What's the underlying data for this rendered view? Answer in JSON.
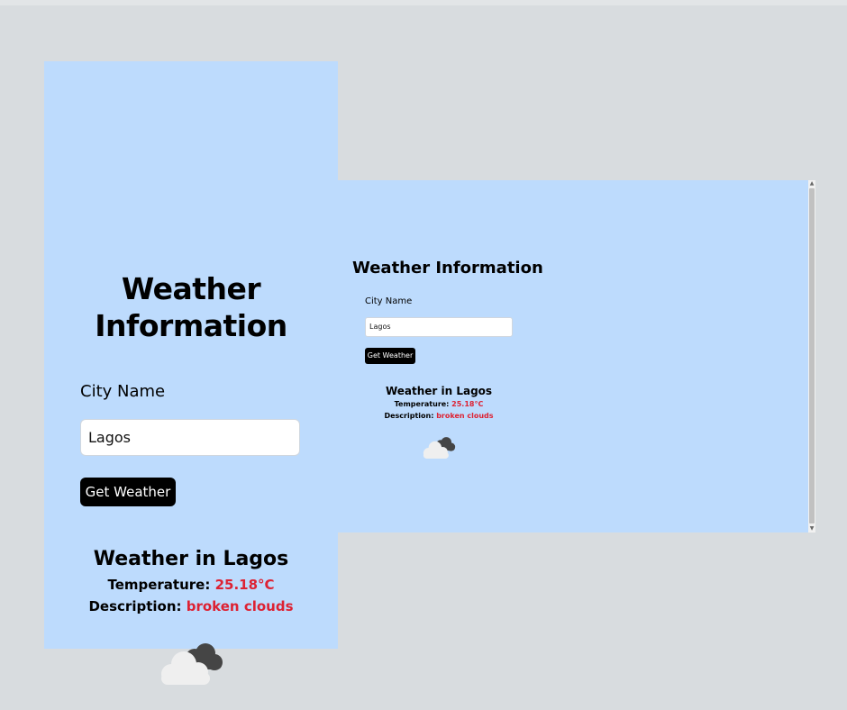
{
  "mobile": {
    "title": "Weather Information",
    "city_label": "City Name",
    "city_value": "Lagos",
    "button_label": "Get Weather",
    "result_title": "Weather in Lagos",
    "temperature_label": "Temperature: ",
    "temperature_value": "25.18°C",
    "description_label": "Description: ",
    "description_value": "broken clouds",
    "weather_icon": "broken-clouds-icon"
  },
  "desktop": {
    "title": "Weather Information",
    "city_label": "City Name",
    "city_value": "Lagos",
    "button_label": "Get Weather",
    "result_title": "Weather in Lagos",
    "temperature_label": "Temperature: ",
    "temperature_value": "25.18°C",
    "description_label": "Description: ",
    "description_value": "broken clouds",
    "weather_icon": "broken-clouds-icon"
  },
  "colors": {
    "page_background": "#d8dcdf",
    "panel_background": "#bddbfd",
    "button_background": "#000000",
    "accent_red": "#dd2233"
  }
}
